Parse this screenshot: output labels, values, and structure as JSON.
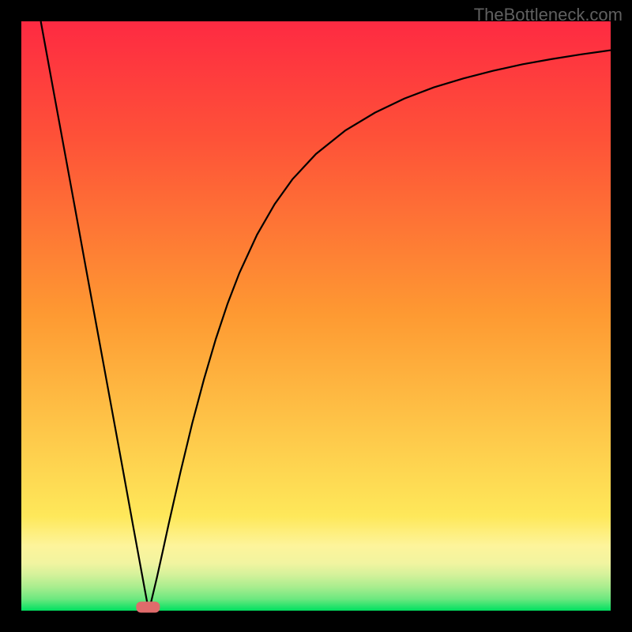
{
  "watermark": "TheBottleneck.com",
  "chart_data": {
    "type": "line",
    "title": "",
    "xlabel": "",
    "ylabel": "",
    "xlim": [
      0,
      100
    ],
    "ylim": [
      0,
      100
    ],
    "minimum_x": 21.5,
    "curve": [
      {
        "x": 3.3,
        "y": 100
      },
      {
        "x": 5,
        "y": 90.7
      },
      {
        "x": 7,
        "y": 79.8
      },
      {
        "x": 9,
        "y": 68.9
      },
      {
        "x": 11,
        "y": 57.9
      },
      {
        "x": 13,
        "y": 47.0
      },
      {
        "x": 15,
        "y": 36.1
      },
      {
        "x": 17,
        "y": 25.2
      },
      {
        "x": 19,
        "y": 14.2
      },
      {
        "x": 21,
        "y": 3.3
      },
      {
        "x": 21.5,
        "y": 0.6
      },
      {
        "x": 22,
        "y": 1.4
      },
      {
        "x": 23,
        "y": 5.6
      },
      {
        "x": 24,
        "y": 10.1
      },
      {
        "x": 25,
        "y": 14.7
      },
      {
        "x": 27,
        "y": 23.5
      },
      {
        "x": 29,
        "y": 31.8
      },
      {
        "x": 31,
        "y": 39.3
      },
      {
        "x": 33,
        "y": 46.1
      },
      {
        "x": 35,
        "y": 52.1
      },
      {
        "x": 37,
        "y": 57.3
      },
      {
        "x": 40,
        "y": 63.8
      },
      {
        "x": 43,
        "y": 69.0
      },
      {
        "x": 46,
        "y": 73.2
      },
      {
        "x": 50,
        "y": 77.5
      },
      {
        "x": 55,
        "y": 81.5
      },
      {
        "x": 60,
        "y": 84.5
      },
      {
        "x": 65,
        "y": 86.9
      },
      {
        "x": 70,
        "y": 88.8
      },
      {
        "x": 75,
        "y": 90.3
      },
      {
        "x": 80,
        "y": 91.6
      },
      {
        "x": 85,
        "y": 92.7
      },
      {
        "x": 90,
        "y": 93.6
      },
      {
        "x": 95,
        "y": 94.4
      },
      {
        "x": 100,
        "y": 95.1
      }
    ],
    "marker": {
      "x": 21.5,
      "y": 0.6,
      "color": "#e06b6b"
    },
    "gradient_bands": [
      {
        "y_start": 0,
        "y_end": 2,
        "color": "#00e060"
      },
      {
        "y_start": 2,
        "y_end": 4,
        "color": "#6de880"
      },
      {
        "y_start": 4,
        "y_end": 6,
        "color": "#a8ed8e"
      },
      {
        "y_start": 6,
        "y_end": 8,
        "color": "#d2f19a"
      },
      {
        "y_start": 8,
        "y_end": 11,
        "color": "#f1f4a0"
      },
      {
        "y_start": 11,
        "y_end": 16,
        "color": "#fdf49b"
      },
      {
        "y_start": 16,
        "y_end": 100,
        "color_gradient_from": "#fee85a",
        "color_gradient_to": "#fe2a42"
      }
    ]
  }
}
